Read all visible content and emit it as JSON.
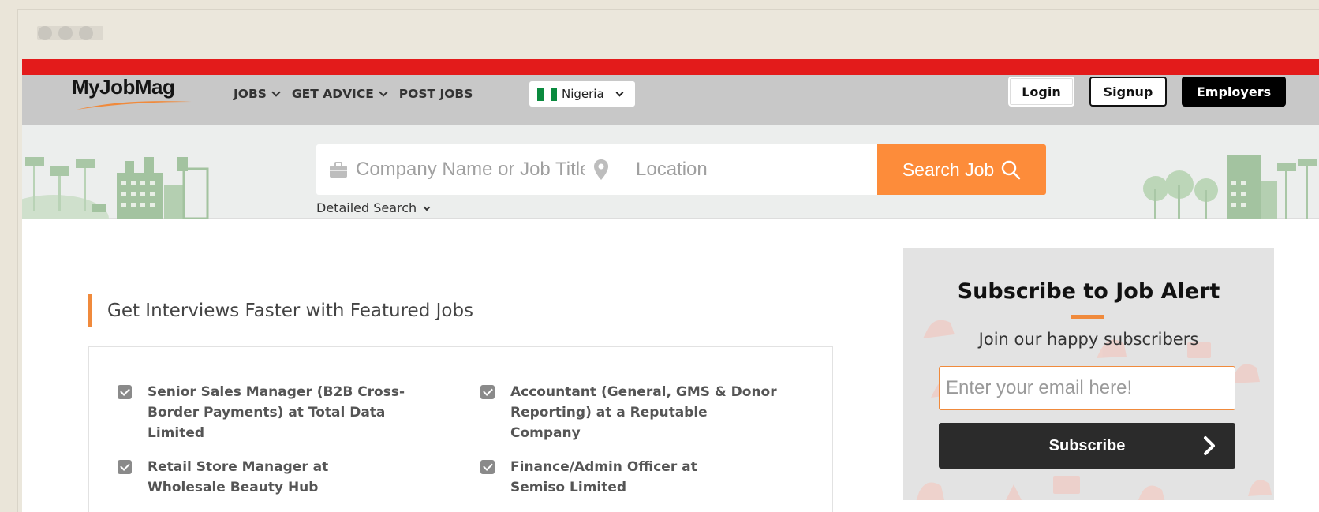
{
  "nav": {
    "logo": "MyJobMag",
    "menu": [
      {
        "label": "JOBS"
      },
      {
        "label": "GET ADVICE"
      },
      {
        "label": "POST JOBS"
      }
    ],
    "country": "Nigeria",
    "login": "Login",
    "signup": "Signup",
    "employers": "Employers"
  },
  "search": {
    "job_placeholder": "Company Name or Job Title",
    "location_placeholder": "Location",
    "button": "Search Job",
    "detailed": "Detailed Search"
  },
  "featured": {
    "title": "Get Interviews Faster with Featured Jobs",
    "jobs": [
      "Senior Sales Manager (B2B Cross-Border Payments) at Total Data Limited",
      "Accountant (General, GMS & Donor Reporting) at a Reputable Company",
      "Retail Store Manager at Wholesale Beauty Hub",
      "Finance/Admin Officer at Semiso Limited"
    ]
  },
  "subscribe": {
    "title": "Subscribe to Job Alert",
    "text": "Join our happy subscribers",
    "email_placeholder": "Enter your email here!",
    "button": "Subscribe"
  },
  "colors": {
    "brand_red": "#e31b1b",
    "accent_orange": "#fd8c3a",
    "nav_gray": "#c8c8c8"
  }
}
